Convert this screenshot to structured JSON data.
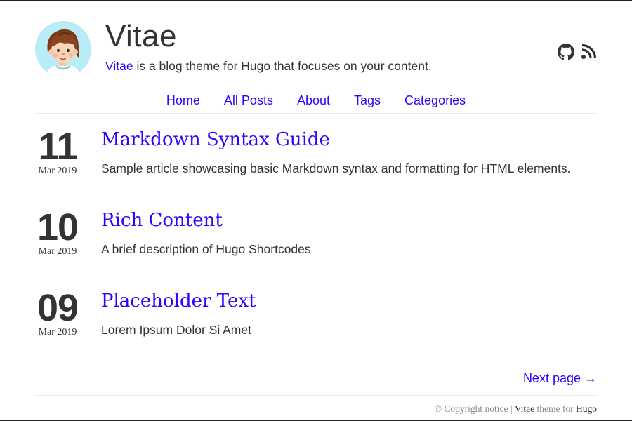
{
  "site": {
    "title": "Vitae",
    "tagline_link": "Vitae",
    "tagline_rest": " is a blog theme for Hugo that focuses on your content."
  },
  "social": [
    {
      "icon": "github-icon"
    },
    {
      "icon": "rss-icon"
    }
  ],
  "nav": [
    "Home",
    "All Posts",
    "About",
    "Tags",
    "Categories"
  ],
  "posts": [
    {
      "day": "11",
      "month": "Mar 2019",
      "title": "Markdown Syntax Guide",
      "summary": "Sample article showcasing basic Markdown syntax and formatting for HTML elements."
    },
    {
      "day": "10",
      "month": "Mar 2019",
      "title": "Rich Content",
      "summary": "A brief description of Hugo Shortcodes"
    },
    {
      "day": "09",
      "month": "Mar 2019",
      "title": "Placeholder Text",
      "summary": "Lorem Ipsum Dolor Si Amet"
    }
  ],
  "pagination": {
    "next": "Next page →"
  },
  "footer": {
    "copyright": "© Copyright notice | ",
    "theme_name": "Vitae",
    "theme_for": " theme for ",
    "engine": "Hugo"
  },
  "colors": {
    "link": "#3300ff",
    "text": "#333333",
    "avatar_bg": "#b9ecf6"
  }
}
